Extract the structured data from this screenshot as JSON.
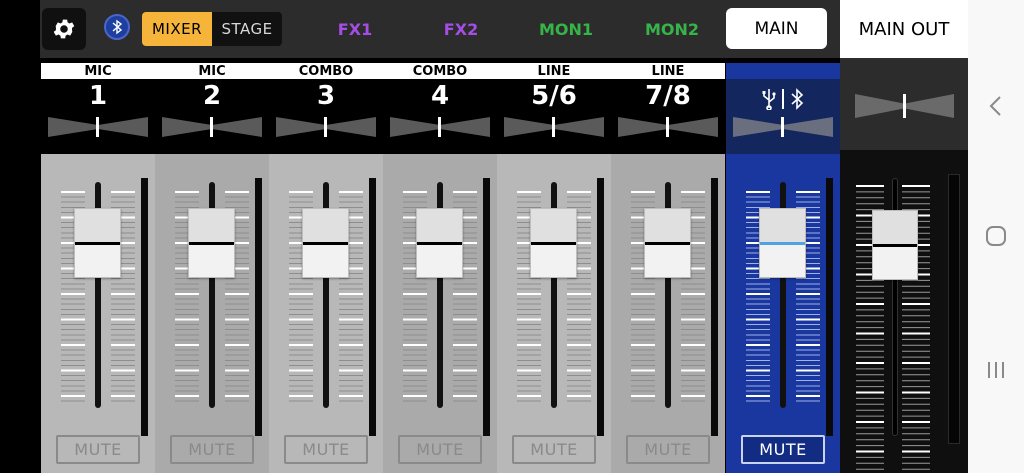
{
  "topbar": {
    "settings_icon": "gear-icon",
    "bluetooth_icon": "bluetooth-icon",
    "mode_toggle": {
      "mixer_label": "MIXER",
      "stage_label": "STAGE",
      "selected": "MIXER"
    },
    "bus_tabs": [
      {
        "label": "FX1",
        "color": "#a44ee6"
      },
      {
        "label": "FX2",
        "color": "#a44ee6"
      },
      {
        "label": "MON1",
        "color": "#37b448"
      },
      {
        "label": "MON2",
        "color": "#37b448"
      }
    ],
    "main_tab": {
      "label": "MAIN",
      "selected": true
    },
    "main_out_label": "MAIN OUT"
  },
  "channels": [
    {
      "type": "MIC",
      "number": "1",
      "mute_label": "MUTE",
      "pan": 0.5,
      "level": 0.8
    },
    {
      "type": "MIC",
      "number": "2",
      "mute_label": "MUTE",
      "pan": 0.5,
      "level": 0.8
    },
    {
      "type": "COMBO",
      "number": "3",
      "mute_label": "MUTE",
      "pan": 0.5,
      "level": 0.8
    },
    {
      "type": "COMBO",
      "number": "4",
      "mute_label": "MUTE",
      "pan": 0.5,
      "level": 0.8
    },
    {
      "type": "LINE",
      "number": "5/6",
      "mute_label": "MUTE",
      "pan": 0.5,
      "level": 0.8
    },
    {
      "type": "LINE",
      "number": "7/8",
      "mute_label": "MUTE",
      "pan": 0.5,
      "level": 0.8
    },
    {
      "type": "",
      "number": "",
      "icons": [
        "usb-icon",
        "bluetooth-icon"
      ],
      "mute_label": "MUTE",
      "pan": 0.5,
      "level": 0.8
    }
  ],
  "master": {
    "pan": 0.5,
    "level": 0.8
  },
  "colors": {
    "accent": "#f6b43a",
    "fx": "#a44ee6",
    "mon": "#37b448",
    "usb_bt_strip": "#1a37a0",
    "usb_bt_head": "#13265e",
    "fader_indicator": "#4fa3e0",
    "strip_light": "#b7b7b7",
    "strip_dark": "#a9a9a9"
  },
  "nav": {
    "back_icon": "back-chevron-icon",
    "home_icon": "home-icon",
    "recents_icon": "recents-icon"
  }
}
